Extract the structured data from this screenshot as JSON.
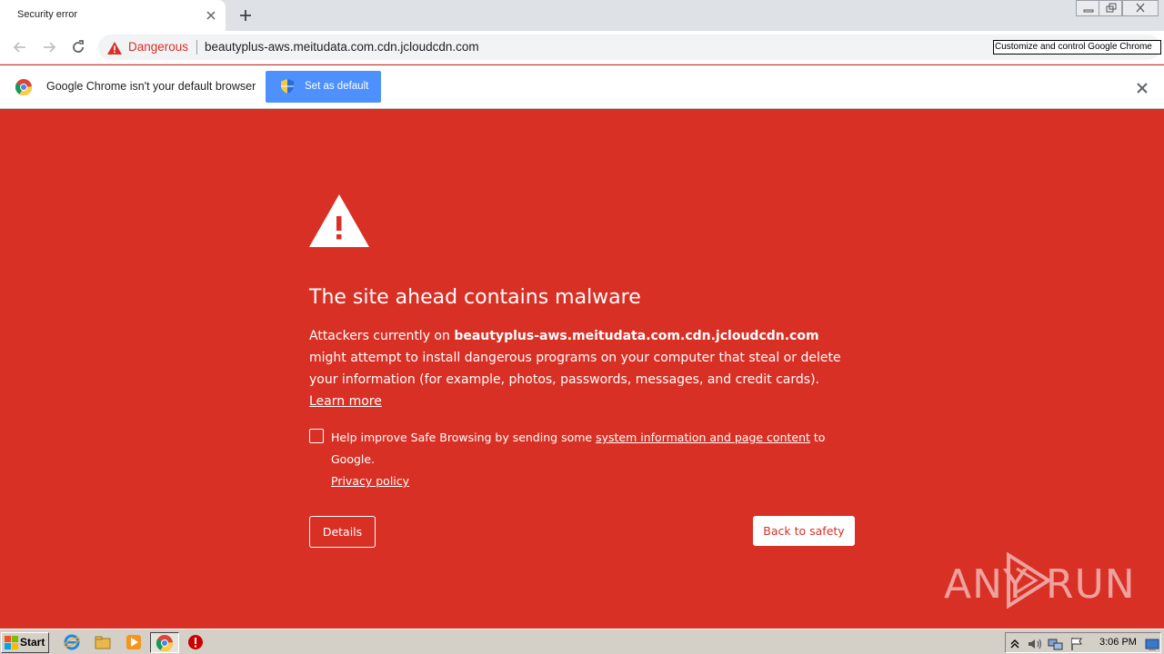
{
  "browser": {
    "tab": {
      "title": "Security error"
    },
    "omnibox": {
      "security_label": "Dangerous",
      "url": "beautyplus-aws.meitudata.com.cdn.jcloudcdn.com"
    },
    "menu_tooltip": "Customize and control Google Chrome"
  },
  "infobar": {
    "message": "Google Chrome isn't your default browser",
    "set_default_label": "Set as default"
  },
  "interstitial": {
    "headline": "The site ahead contains malware",
    "para_prefix": "Attackers currently on ",
    "para_host": "beautyplus-aws.meitudata.com.cdn.jcloudcdn.com",
    "para_suffix": " might attempt to install dangerous programs on your computer that steal or delete your information (for example, photos, passwords, messages, and credit cards). ",
    "learn_more": "Learn more",
    "optin_prefix": "Help improve Safe Browsing by sending some ",
    "optin_link": "system information and page content",
    "optin_suffix": " to Google.",
    "privacy_policy": "Privacy policy",
    "optin_checked": false,
    "details_label": "Details",
    "back_label": "Back to safety"
  },
  "watermark": {
    "left": "ANY",
    "right": "RUN"
  },
  "taskbar": {
    "start_label": "Start",
    "clock": "3:06 PM"
  },
  "colors": {
    "danger_red": "#d93025",
    "infobar_button": "#4d90fe",
    "taskbar": "#d4d0c8"
  }
}
